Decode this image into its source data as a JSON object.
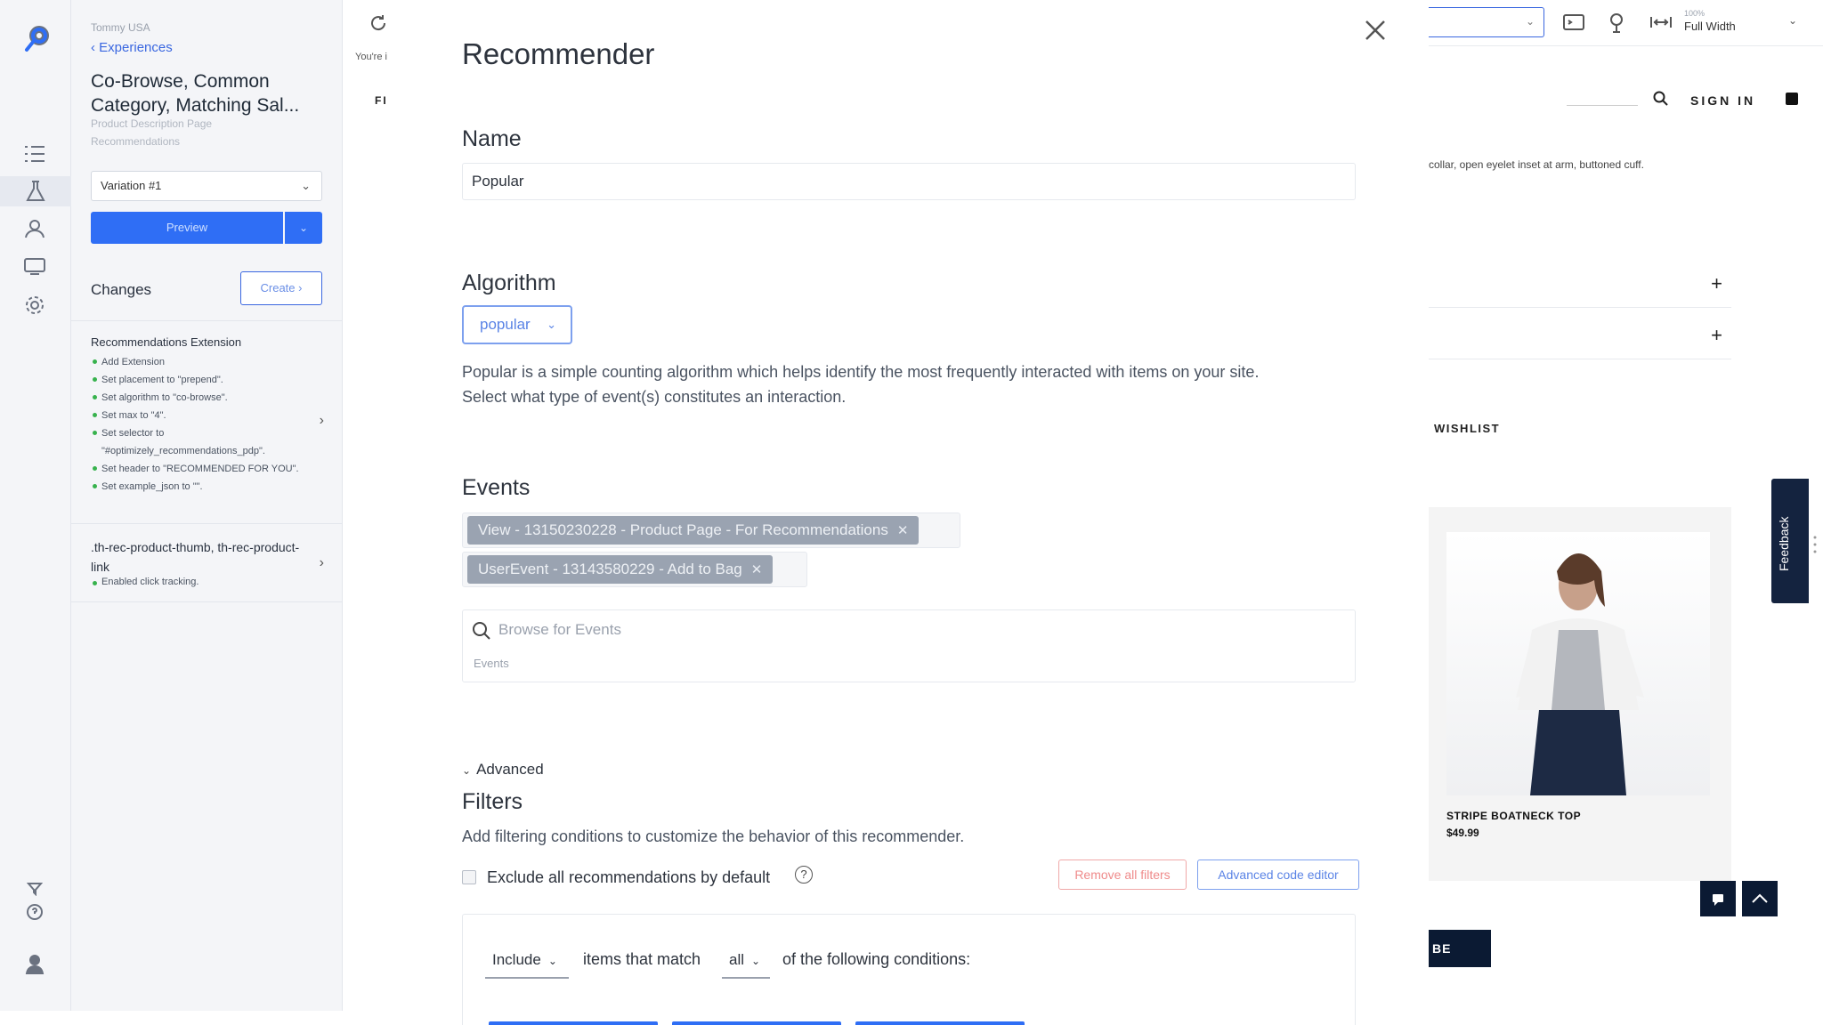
{
  "rail": {
    "icons": [
      "logo-icon",
      "list-icon",
      "flask-icon",
      "audiences-icon",
      "screen-icon",
      "gear-icon",
      "funnel-icon",
      "help-icon",
      "user-avatar-icon"
    ]
  },
  "experience": {
    "project": "Tommy USA",
    "back_label": "Experiences",
    "title": "Co-Browse, Common Category, Matching Sal...",
    "subtitle1": "Product Description Page",
    "subtitle2": "Recommendations",
    "variation": "Variation #1",
    "preview_label": "Preview",
    "changes_label": "Changes",
    "create_label": "Create",
    "extension": {
      "title": "Recommendations Extension",
      "items": [
        "Add Extension",
        "Set placement to \"prepend\".",
        "Set algorithm to \"co-browse\".",
        "Set max to \"4\".",
        "Set selector to \"#optimizely_recommendations_pdp\".",
        "Set header to \"RECOMMENDED FOR YOU\".",
        "Set example_json to \"\"."
      ]
    },
    "selector_change": {
      "title": ".th-rec-product-thumb, th-rec-product-link",
      "note": "Enabled click tracking."
    }
  },
  "middle": {
    "youre_in": "You're i",
    "fi": "FI"
  },
  "modal": {
    "title": "Recommender",
    "name_label": "Name",
    "name_value": "Popular",
    "algorithm_label": "Algorithm",
    "algorithm_value": "popular",
    "algorithm_desc_line1": "Popular is a simple counting algorithm which helps identify the most frequently interacted with items on your site.",
    "algorithm_desc_line2": "Select what type of event(s) constitutes an interaction.",
    "events_label": "Events",
    "events": [
      "View - 13150230228 - Product Page - For Recommendations",
      "UserEvent - 13143580229 - Add to Bag"
    ],
    "event_search_placeholder": "Browse for Events",
    "event_search_sub": "Events",
    "advanced_label": "Advanced",
    "filters_label": "Filters",
    "filters_desc": "Add filtering conditions to customize the behavior of this recommender.",
    "exclude_label": "Exclude all recommendations by default",
    "help_glyph": "?",
    "remove_filters_label": "Remove all filters",
    "advanced_code_label": "Advanced code editor",
    "condition": {
      "mode": "Include",
      "text1": "items that match",
      "match": "all",
      "text2": "of the following conditions:"
    }
  },
  "preview_site": {
    "toolbar": {
      "zoom": "100%",
      "width_label": "Full Width"
    },
    "sign_in": "SIGN IN",
    "product_desc_fragment": "collar, open eyelet inset at arm, buttoned cuff.",
    "wishlist": "WISHLIST",
    "product_name": "STRIPE BOATNECK TOP",
    "product_price": "$49.99",
    "feedback": "Feedback",
    "subscribe_fragment": "BE"
  },
  "colors": {
    "accent": "#2f6ef5",
    "chip_bg": "#9aa3b1",
    "danger": "#ef8b8b",
    "navy": "#0b1a33"
  }
}
